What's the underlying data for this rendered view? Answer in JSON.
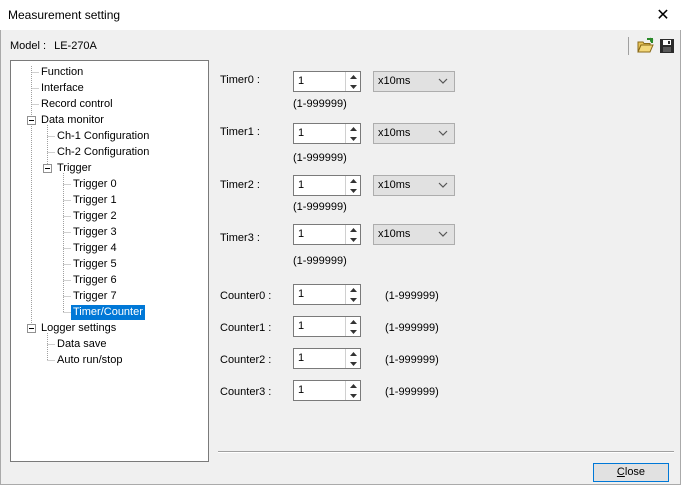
{
  "window": {
    "title": "Measurement setting",
    "close_glyph": "✕"
  },
  "model": {
    "label": "Model :",
    "value": "LE-270A"
  },
  "toolbar": {
    "open_icon": "folder-open-icon",
    "save_icon": "save-icon"
  },
  "tree": {
    "function": "Function",
    "interface": "Interface",
    "record_control": "Record control",
    "data_monitor": "Data monitor",
    "ch1": "Ch-1 Configuration",
    "ch2": "Ch-2 Configuration",
    "trigger": "Trigger",
    "triggers": [
      "Trigger 0",
      "Trigger 1",
      "Trigger 2",
      "Trigger 3",
      "Trigger 4",
      "Trigger 5",
      "Trigger 6",
      "Trigger 7"
    ],
    "timer_counter": "Timer/Counter",
    "logger_settings": "Logger settings",
    "data_save": "Data save",
    "auto_run_stop": "Auto run/stop"
  },
  "timers": [
    {
      "label": "Timer0 :",
      "value": "1",
      "unit": "x10ms",
      "range": "(1-999999)"
    },
    {
      "label": "Timer1 :",
      "value": "1",
      "unit": "x10ms",
      "range": "(1-999999)"
    },
    {
      "label": "Timer2 :",
      "value": "1",
      "unit": "x10ms",
      "range": "(1-999999)"
    },
    {
      "label": "Timer3 :",
      "value": "1",
      "unit": "x10ms",
      "range": "(1-999999)"
    }
  ],
  "counters": [
    {
      "label": "Counter0 :",
      "value": "1",
      "range": "(1-999999)"
    },
    {
      "label": "Counter1 :",
      "value": "1",
      "range": "(1-999999)"
    },
    {
      "label": "Counter2 :",
      "value": "1",
      "range": "(1-999999)"
    },
    {
      "label": "Counter3 :",
      "value": "1",
      "range": "(1-999999)"
    }
  ],
  "buttons": {
    "close_first": "C",
    "close_rest": "lose"
  }
}
